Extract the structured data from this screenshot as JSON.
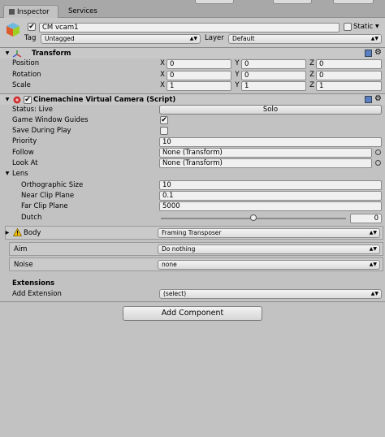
{
  "tabs": [
    {
      "label": "Inspector"
    },
    {
      "label": "Services"
    }
  ],
  "gameobject": {
    "name": "CM vcam1",
    "static_label": "Static",
    "tag_label": "Tag",
    "tag_value": "Untagged",
    "layer_label": "Layer",
    "layer_value": "Default"
  },
  "transform": {
    "title": "Transform",
    "rows": [
      {
        "label": "Position",
        "x": "0",
        "y": "0",
        "z": "0"
      },
      {
        "label": "Rotation",
        "x": "0",
        "y": "0",
        "z": "0"
      },
      {
        "label": "Scale",
        "x": "1",
        "y": "1",
        "z": "1"
      }
    ],
    "axis": {
      "x": "X",
      "y": "Y",
      "z": "Z"
    }
  },
  "vcam": {
    "title": "Cinemachine Virtual Camera (Script)",
    "status_label": "Status: Live",
    "solo_label": "Solo",
    "game_window_guides_label": "Game Window Guides",
    "game_window_guides_checked": true,
    "save_during_play_label": "Save During Play",
    "save_during_play_checked": false,
    "priority_label": "Priority",
    "priority_value": "10",
    "follow_label": "Follow",
    "follow_value": "None (Transform)",
    "lookat_label": "Look At",
    "lookat_value": "None (Transform)",
    "lens_label": "Lens",
    "ortho_label": "Orthographic Size",
    "ortho_value": "10",
    "near_label": "Near Clip Plane",
    "near_value": "0.1",
    "far_label": "Far Clip Plane",
    "far_value": "5000",
    "dutch_label": "Dutch",
    "dutch_value": "0",
    "dutch_fraction": 0.5,
    "body_label": "Body",
    "body_value": "Framing Transposer",
    "aim_label": "Aim",
    "aim_value": "Do nothing",
    "noise_label": "Noise",
    "noise_value": "none",
    "extensions_label": "Extensions",
    "add_extension_label": "Add Extension",
    "add_extension_value": "(select)"
  },
  "add_component_label": "Add Component",
  "colors": {
    "panel": "#c2c2c2",
    "header": "#c8c8c8",
    "warning": "#f0c000"
  }
}
